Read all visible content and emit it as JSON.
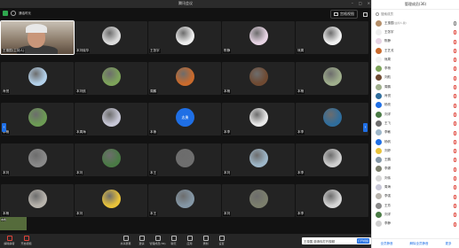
{
  "window": {
    "title": "腾讯会议"
  },
  "topbar": {
    "time": "通话时长",
    "gallery_label": "宫格视图"
  },
  "tiles": [
    {
      "name": "王惠国(主持人)",
      "kind": "video"
    },
    {
      "name": "本刘晓华",
      "kind": "avatar",
      "color": "#dcdcdc"
    },
    {
      "name": "王张宇",
      "kind": "avatar",
      "color": "#eeeeee"
    },
    {
      "name": "陈静",
      "kind": "avatar",
      "color": "#e7d4e4"
    },
    {
      "name": "熊周",
      "kind": "avatar",
      "color": "#f1f1f1"
    },
    {
      "name": "肖悦",
      "kind": "avatar",
      "color": "#b3d1ea"
    },
    {
      "name": "本刘航",
      "kind": "avatar",
      "color": "#7da35a"
    },
    {
      "name": "周鹏",
      "kind": "avatar",
      "color": "#c96a2c"
    },
    {
      "name": "本杨",
      "kind": "avatar",
      "color": "#6f4a32"
    },
    {
      "name": "本杨",
      "kind": "avatar",
      "color": "#9fae8c"
    },
    {
      "name": "本杨",
      "kind": "avatar",
      "color": "#6c9b54"
    },
    {
      "name": "本周海",
      "kind": "avatar",
      "color": "#c7c7d6"
    },
    {
      "name": "本熊",
      "kind": "text",
      "label": "志勇"
    },
    {
      "name": "本李",
      "kind": "avatar",
      "color": "#e9e9e9"
    },
    {
      "name": "本李",
      "kind": "avatar",
      "color": "#2f6d9c"
    },
    {
      "name": "本刘",
      "kind": "avatar",
      "color": "#8a8a8a"
    },
    {
      "name": "本刘",
      "kind": "avatar",
      "color": "#4a7a45"
    },
    {
      "name": "本王",
      "kind": "avatar",
      "color": "#6e6e6e"
    },
    {
      "name": "本刘",
      "kind": "avatar",
      "color": "#9eb7c9"
    },
    {
      "name": "本李",
      "kind": "avatar",
      "color": "#cfcfcf"
    },
    {
      "name": "本杨",
      "kind": "avatar",
      "color": "#b8b4ad"
    },
    {
      "name": "本刘",
      "kind": "avatar",
      "color": "#e8c23a"
    },
    {
      "name": "本王",
      "kind": "avatar",
      "color": "#8497a6"
    },
    {
      "name": "本刘",
      "kind": "avatar",
      "color": "#7c7f6d"
    },
    {
      "name": "本李",
      "kind": "avatar",
      "color": "#d6d6d6"
    }
  ],
  "selfview": {
    "name": "本杨"
  },
  "toolbar": {
    "left": [
      {
        "label": "解除静音"
      },
      {
        "label": "开启视频"
      }
    ],
    "center": [
      {
        "label": "共享屏幕"
      },
      {
        "label": "邀请"
      },
      {
        "label": "管理成员(36)"
      },
      {
        "label": "聊天"
      },
      {
        "label": "应用"
      },
      {
        "label": "录制"
      },
      {
        "label": "设置"
      }
    ],
    "end_label": "结束会议"
  },
  "toast": {
    "text": "王惠国 邀请你打开视频",
    "ok": "打开视频"
  },
  "panel": {
    "title": "管理成员(36)",
    "search_placeholder": "搜索成员",
    "participants": [
      {
        "name": "王惠国",
        "sub": "(主持人,我)",
        "color": "#b48f6a",
        "mic": "on"
      },
      {
        "name": "王张宇",
        "sub": "",
        "color": "#eeeeee",
        "mic": "off"
      },
      {
        "name": "陈静",
        "sub": "",
        "color": "#e7d4e4",
        "mic": "off"
      },
      {
        "name": "王艺戈",
        "sub": "",
        "color": "#c96a2c",
        "mic": "off"
      },
      {
        "name": "熊周",
        "sub": "",
        "color": "#f1f1f1",
        "mic": "off"
      },
      {
        "name": "李杨",
        "sub": "",
        "color": "#7da35a",
        "mic": "off"
      },
      {
        "name": "刘航",
        "sub": "",
        "color": "#6f4a32",
        "mic": "off"
      },
      {
        "name": "周鹏",
        "sub": "",
        "color": "#9fae8c",
        "mic": "off"
      },
      {
        "name": "肖悦",
        "sub": "",
        "color": "#2f6d9c",
        "mic": "off"
      },
      {
        "name": "杨亮",
        "sub": "",
        "color": "#1f6fe5",
        "mic": "off"
      },
      {
        "name": "刘洋",
        "sub": "",
        "color": "#4a7a45",
        "mic": "off"
      },
      {
        "name": "王飞",
        "sub": "",
        "color": "#6e6e6e",
        "mic": "off"
      },
      {
        "name": "李敏",
        "sub": "",
        "color": "#9eb7c9",
        "mic": "off"
      },
      {
        "name": "杨帆",
        "sub": "",
        "color": "#1f6fe5",
        "mic": "off"
      },
      {
        "name": "刘婷",
        "sub": "",
        "color": "#e8c23a",
        "mic": "off"
      },
      {
        "name": "王鹏",
        "sub": "",
        "color": "#8497a6",
        "mic": "off"
      },
      {
        "name": "李娜",
        "sub": "",
        "color": "#7c7f6d",
        "mic": "off"
      },
      {
        "name": "刘伟",
        "sub": "",
        "color": "#d6d6d6",
        "mic": "off"
      },
      {
        "name": "周海",
        "sub": "",
        "color": "#c7c7d6",
        "mic": "off"
      },
      {
        "name": "李强",
        "sub": "",
        "color": "#b8b4ad",
        "mic": "off"
      },
      {
        "name": "王芳",
        "sub": "",
        "color": "#8a8a8a",
        "mic": "off"
      },
      {
        "name": "刘洋",
        "sub": "",
        "color": "#4a7a45",
        "mic": "off"
      },
      {
        "name": "李静",
        "sub": "",
        "color": "#cfcfcf",
        "mic": "off"
      }
    ],
    "footer": [
      "全员静音",
      "解除全员静音",
      "更多"
    ]
  }
}
